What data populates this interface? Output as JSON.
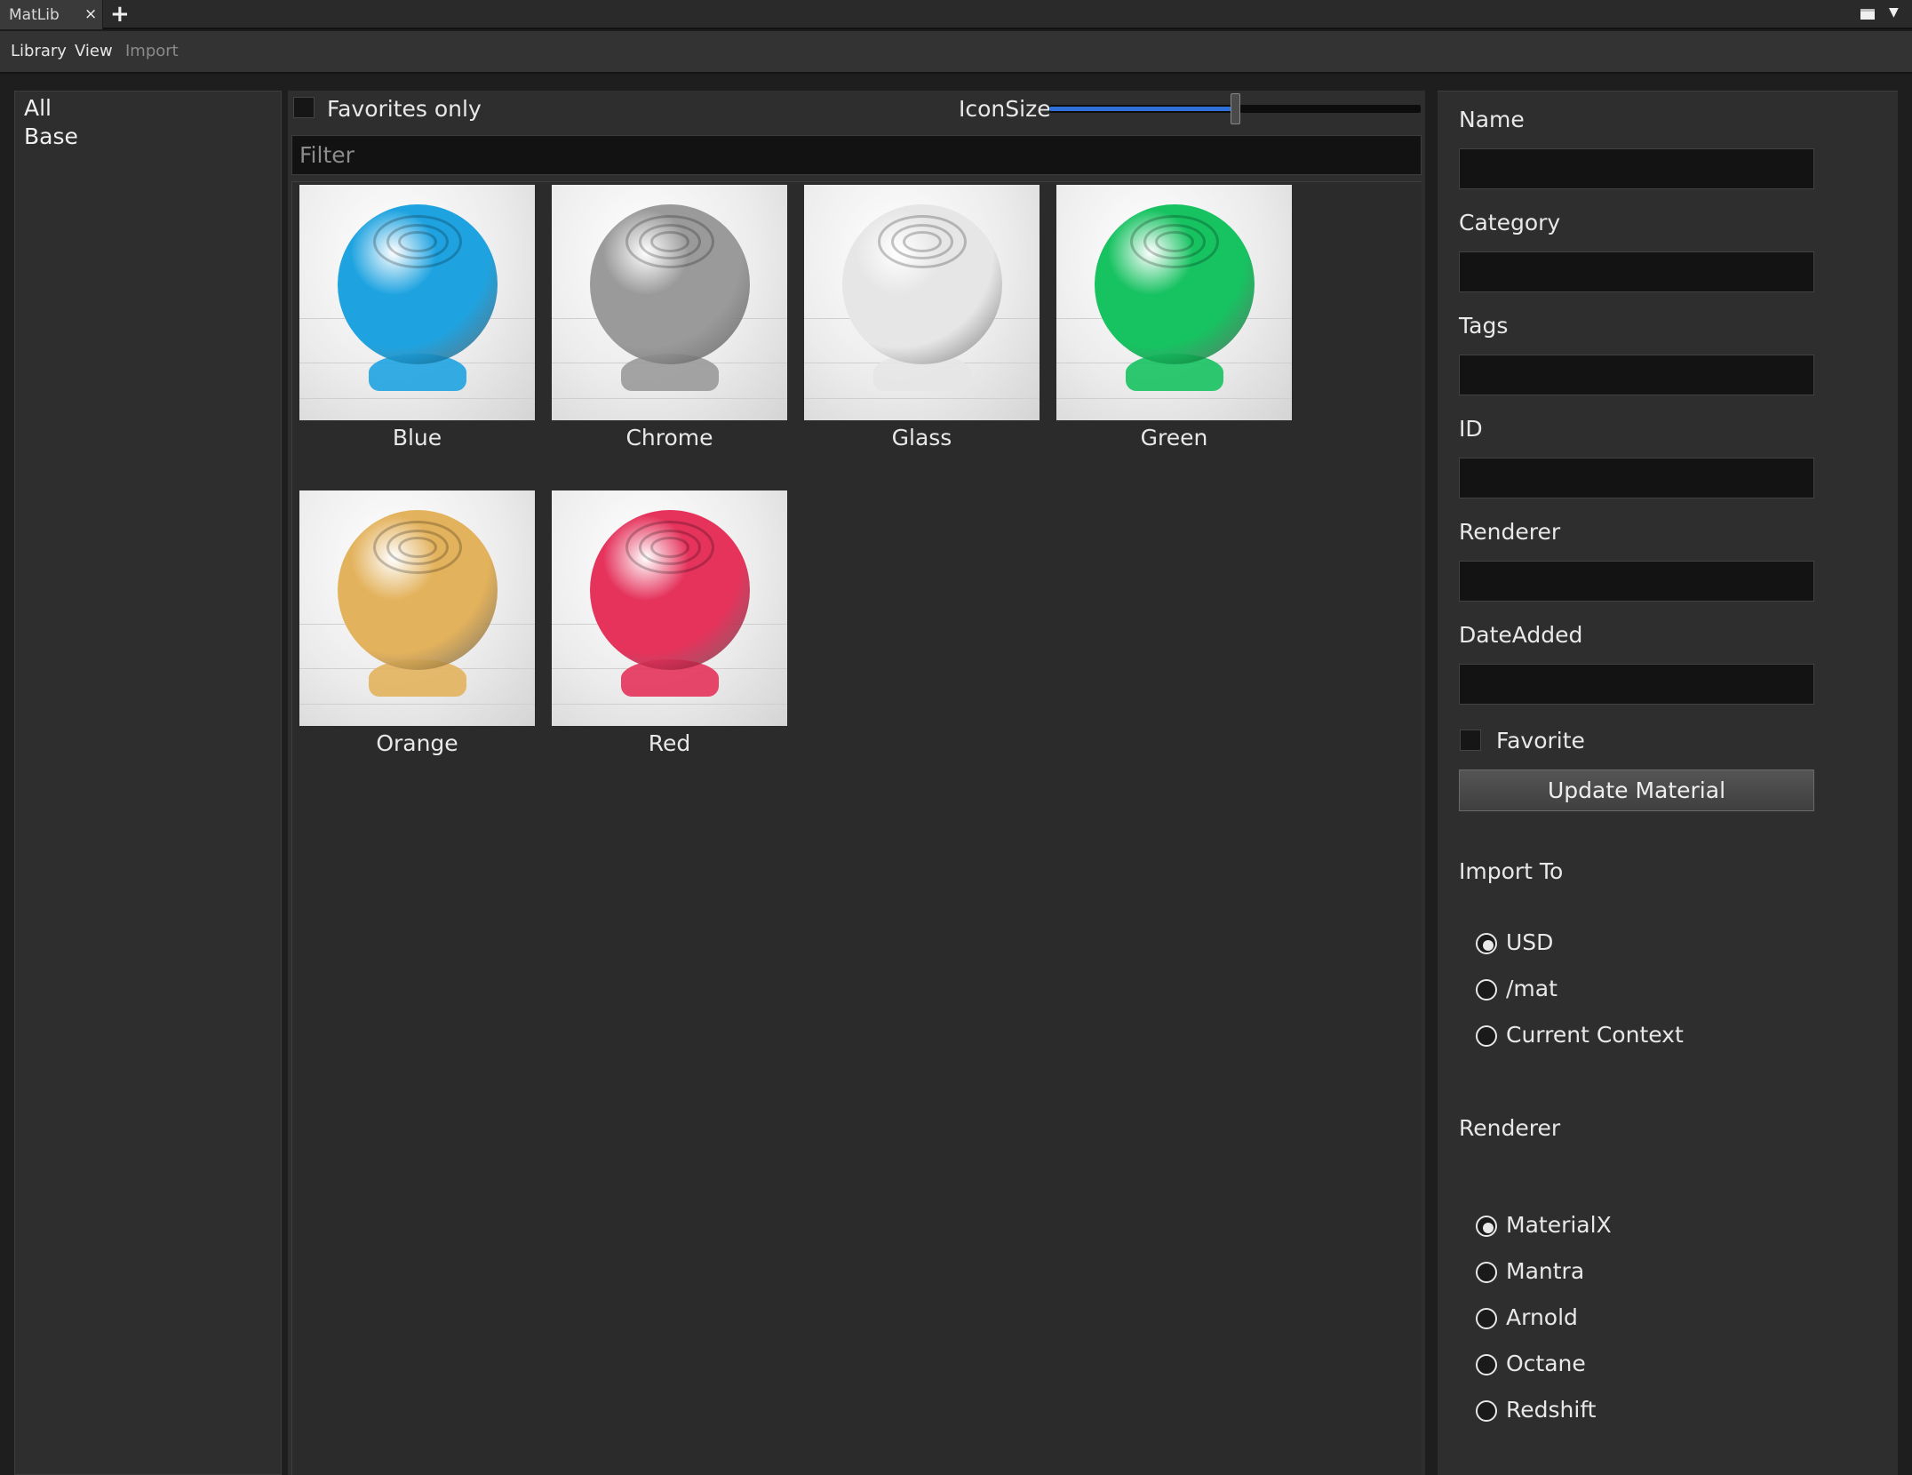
{
  "tab": {
    "title": "MatLib",
    "close": "×",
    "add": "+"
  },
  "pane_menu": {
    "caret": "▼"
  },
  "menubar": {
    "library": "Library",
    "view": "View",
    "import": "Import"
  },
  "categories": [
    "All",
    "Base"
  ],
  "toolbar": {
    "favorites_only_label": "Favorites only",
    "favorites_only_checked": false,
    "iconsize_label": "IconSize",
    "iconsize_value": 0.5
  },
  "filter": {
    "placeholder": "Filter",
    "value": ""
  },
  "materials": [
    {
      "name": "Blue",
      "color": "#1fa3e0"
    },
    {
      "name": "Chrome",
      "color": "#9a9a9a"
    },
    {
      "name": "Glass",
      "color": "#e6e6e6"
    },
    {
      "name": "Green",
      "color": "#17c261"
    },
    {
      "name": "Orange",
      "color": "#e3b25c"
    },
    {
      "name": "Red",
      "color": "#e5335c"
    }
  ],
  "properties": {
    "name_label": "Name",
    "category_label": "Category",
    "tags_label": "Tags",
    "id_label": "ID",
    "renderer_label": "Renderer",
    "dateadded_label": "DateAdded",
    "favorite_label": "Favorite",
    "favorite_checked": false,
    "update_button": "Update Material"
  },
  "import_to": {
    "label": "Import To",
    "options": [
      "USD",
      "/mat",
      "Current Context"
    ],
    "selected": "USD"
  },
  "renderer": {
    "label": "Renderer",
    "options": [
      "MaterialX",
      "Mantra",
      "Arnold",
      "Octane",
      "Redshift"
    ],
    "selected": "MaterialX"
  },
  "colors": {
    "accent": "#2f6fd8",
    "panel": "#2e2e2e",
    "input": "#131313"
  }
}
